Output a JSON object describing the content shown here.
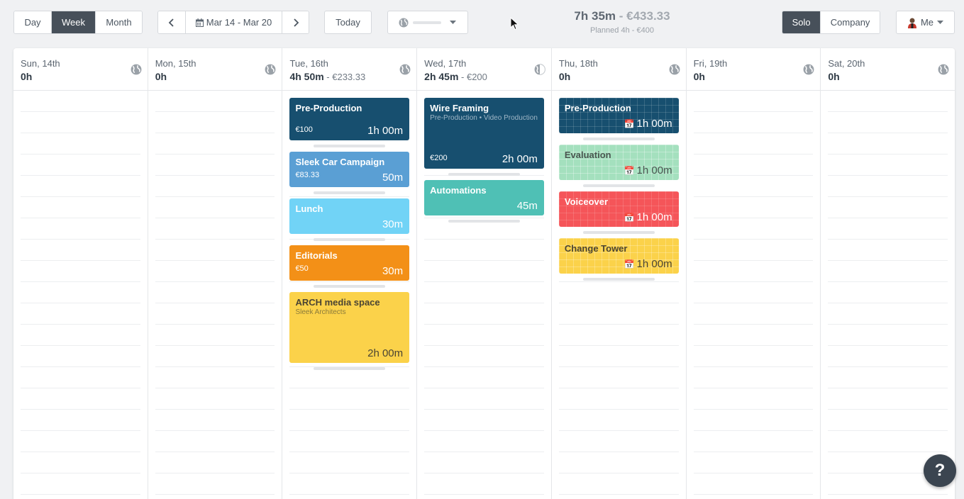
{
  "view_switch": {
    "day": "Day",
    "week": "Week",
    "month": "Month",
    "active": "Week"
  },
  "date_nav": {
    "range": "Mar 14 - Mar 20"
  },
  "today_label": "Today",
  "summary": {
    "tracked": "7h 35m",
    "separator": " - ",
    "amount": "€433.33",
    "planned": "Planned 4h - €400"
  },
  "mode_switch": {
    "solo": "Solo",
    "company": "Company",
    "active": "Solo"
  },
  "user_menu": {
    "label": "Me"
  },
  "days": [
    {
      "date": "Sun, 14th",
      "total": "0h",
      "money": ""
    },
    {
      "date": "Mon, 15th",
      "total": "0h",
      "money": ""
    },
    {
      "date": "Tue, 16th",
      "total": "4h 50m",
      "money": " - €233.33"
    },
    {
      "date": "Wed, 17th",
      "total": "2h 45m",
      "money": " - €200"
    },
    {
      "date": "Thu, 18th",
      "total": "0h",
      "money": ""
    },
    {
      "date": "Fri, 19th",
      "total": "0h",
      "money": ""
    },
    {
      "date": "Sat, 20th",
      "total": "0h",
      "money": ""
    }
  ],
  "entries": {
    "tue": [
      {
        "title": "Pre-Production",
        "money": "€100",
        "duration": "1h 00m"
      },
      {
        "title": "Sleek Car Campaign",
        "money": "€83.33",
        "duration": "50m"
      },
      {
        "title": "Lunch",
        "duration": "30m"
      },
      {
        "title": "Editorials",
        "money": "€50",
        "duration": "30m"
      },
      {
        "title": "ARCH media space",
        "subtitle": "Sleek Architects",
        "duration": "2h 00m"
      }
    ],
    "wed": [
      {
        "title": "Wire Framing",
        "subtitle": "Pre-Production • Video Production",
        "money": "€200",
        "duration": "2h 00m"
      },
      {
        "title": "Automations",
        "duration": "45m"
      }
    ],
    "thu": [
      {
        "title": "Pre-Production",
        "duration": "1h 00m"
      },
      {
        "title": "Evaluation",
        "duration": "1h 00m"
      },
      {
        "title": "Voiceover",
        "duration": "1h 00m"
      },
      {
        "title": "Change Tower",
        "duration": "1h 00m"
      }
    ]
  },
  "help_label": "?",
  "colors": {
    "dark": "#174f6f",
    "blue": "#5a9fd4",
    "lightblue": "#71d3f6",
    "orange": "#f39017",
    "yellow": "#fbd24a",
    "teal": "#4fc0b5",
    "green": "#a4e0be",
    "red": "#f55559"
  }
}
